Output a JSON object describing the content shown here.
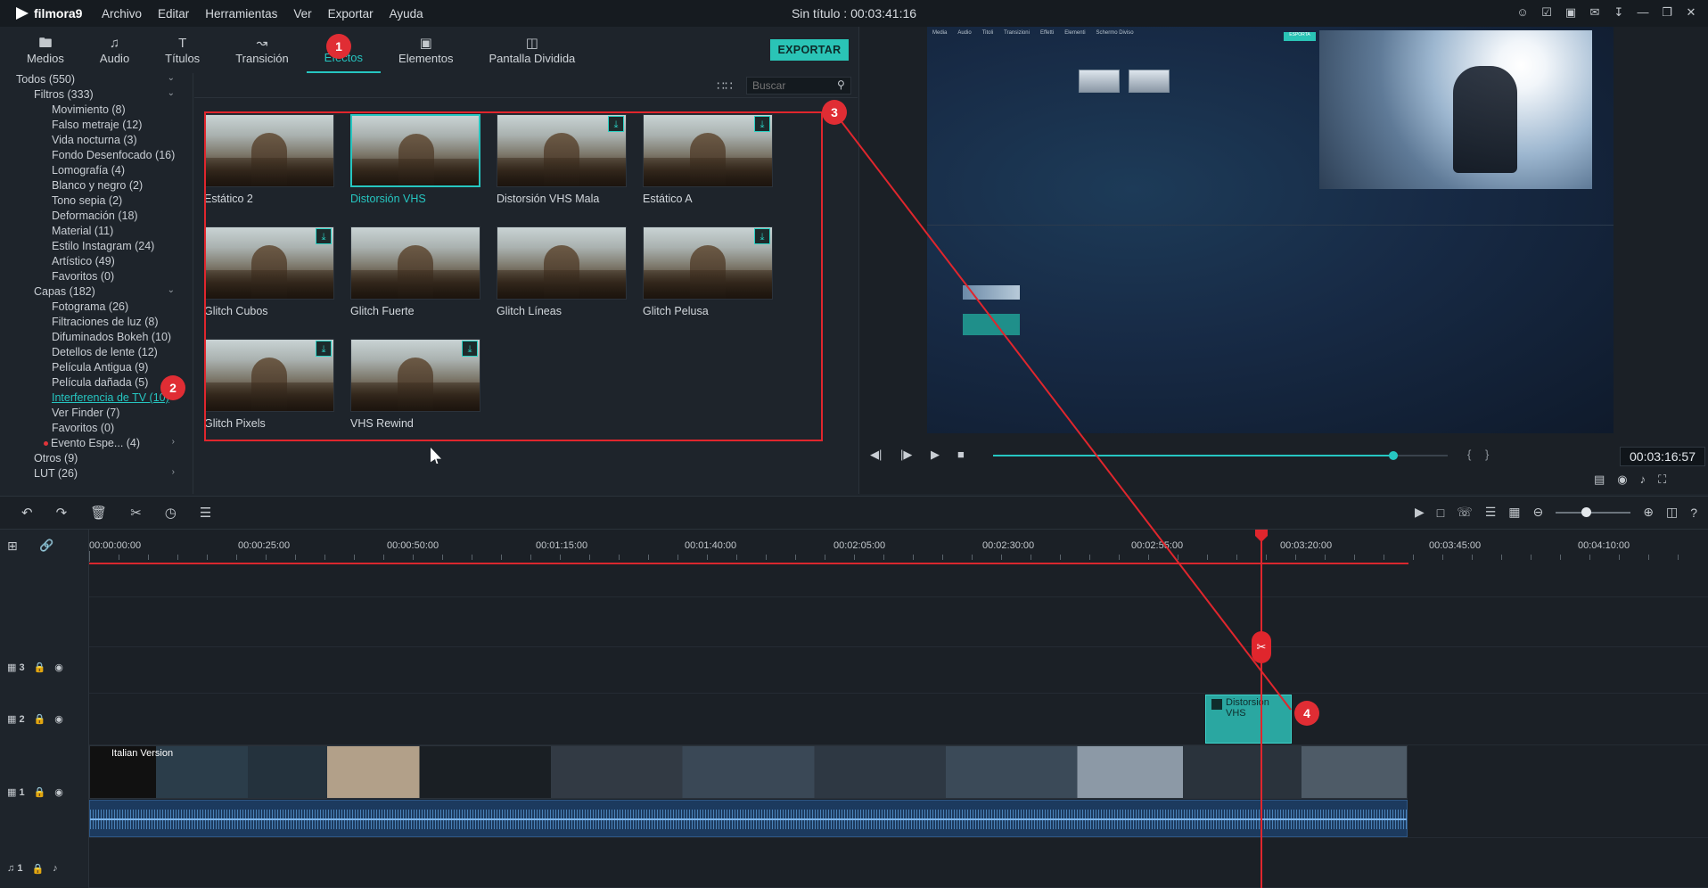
{
  "app": {
    "brand": "filmora9",
    "window_title": "Sin título : 00:03:41:16",
    "menu": [
      "Archivo",
      "Editar",
      "Herramientas",
      "Ver",
      "Exportar",
      "Ayuda"
    ],
    "window_controls": [
      "user-icon",
      "cart-icon",
      "save-icon",
      "mail-icon",
      "download-icon",
      "minimize-icon",
      "restore-icon",
      "close-icon"
    ]
  },
  "tabs": [
    {
      "label": "Medios",
      "icon": "folder-icon"
    },
    {
      "label": "Audio",
      "icon": "music-note-icon"
    },
    {
      "label": "Títulos",
      "icon": "text-icon"
    },
    {
      "label": "Transición",
      "icon": "transition-icon"
    },
    {
      "label": "Efectos",
      "icon": "effects-icon"
    },
    {
      "label": "Elementos",
      "icon": "image-icon"
    },
    {
      "label": "Pantalla Dividida",
      "icon": "split-screen-icon"
    }
  ],
  "active_tab": "Efectos",
  "export_label": "EXPORTAR",
  "tree": [
    {
      "label": "Todos (550)"
    },
    {
      "label": "Filtros (333)"
    },
    {
      "label": "Movimiento (8)"
    },
    {
      "label": "Falso metraje (12)"
    },
    {
      "label": "Vida nocturna (3)"
    },
    {
      "label": "Fondo Desenfocado (16)"
    },
    {
      "label": "Lomografía (4)"
    },
    {
      "label": "Blanco y negro (2)"
    },
    {
      "label": "Tono sepia (2)"
    },
    {
      "label": "Deformación (18)"
    },
    {
      "label": "Material (11)"
    },
    {
      "label": "Estilo Instagram (24)"
    },
    {
      "label": "Artístico (49)"
    },
    {
      "label": "Favoritos (0)"
    },
    {
      "label": "Capas (182)"
    },
    {
      "label": "Fotograma (26)"
    },
    {
      "label": "Filtraciones de luz (8)"
    },
    {
      "label": "Difuminados Bokeh (10)"
    },
    {
      "label": "Detellos de lente (12)"
    },
    {
      "label": "Película Antigua (9)"
    },
    {
      "label": "Película dañada (5)"
    },
    {
      "label": "Interferencia de TV (10)"
    },
    {
      "label": "Ver Finder (7)"
    },
    {
      "label": "Favoritos (0)"
    },
    {
      "label": "Evento Espe... (4)"
    },
    {
      "label": "Otros (9)"
    },
    {
      "label": "LUT (26)"
    }
  ],
  "search_placeholder": "Buscar",
  "effects": [
    {
      "label": "Estático 2",
      "download": false,
      "selected": false
    },
    {
      "label": "Distorsión VHS",
      "download": false,
      "selected": true
    },
    {
      "label": "Distorsión VHS Mala",
      "download": true,
      "selected": false
    },
    {
      "label": "Estático A",
      "download": true,
      "selected": false
    },
    {
      "label": "Glitch Cubos",
      "download": true,
      "selected": false
    },
    {
      "label": "Glitch Fuerte",
      "download": false,
      "selected": false
    },
    {
      "label": "Glitch Líneas",
      "download": false,
      "selected": false
    },
    {
      "label": "Glitch Pelusa",
      "download": true,
      "selected": false
    },
    {
      "label": "Glitch Pixels",
      "download": true,
      "selected": false
    },
    {
      "label": "VHS Rewind",
      "download": true,
      "selected": false
    }
  ],
  "badges": [
    "1",
    "2",
    "3",
    "4"
  ],
  "preview": {
    "timecode": "00:03:16:57",
    "progress": 0.88,
    "brackets": "{ }",
    "mini_menu": [
      "Media",
      "Audio",
      "Titoli",
      "Transizioni",
      "Effetti",
      "Elementi",
      "Schermo Diviso"
    ],
    "mini_export": "ESPORTA"
  },
  "ruler": {
    "labels": [
      "00:00:00:00",
      "00:00:25:00",
      "00:00:50:00",
      "00:01:15:00",
      "00:01:40:00",
      "00:02:05:00",
      "00:02:30:00",
      "00:02:55:00",
      "00:03:20:00",
      "00:03:45:00",
      "00:04:10:00"
    ]
  },
  "tracks": [
    {
      "name": "3"
    },
    {
      "name": "2"
    },
    {
      "name": "1"
    },
    {
      "name": "1"
    }
  ],
  "clips": {
    "video_title": "Italian Version",
    "effect_name": "Distorsión VHS"
  },
  "zoom_level": 0.4
}
